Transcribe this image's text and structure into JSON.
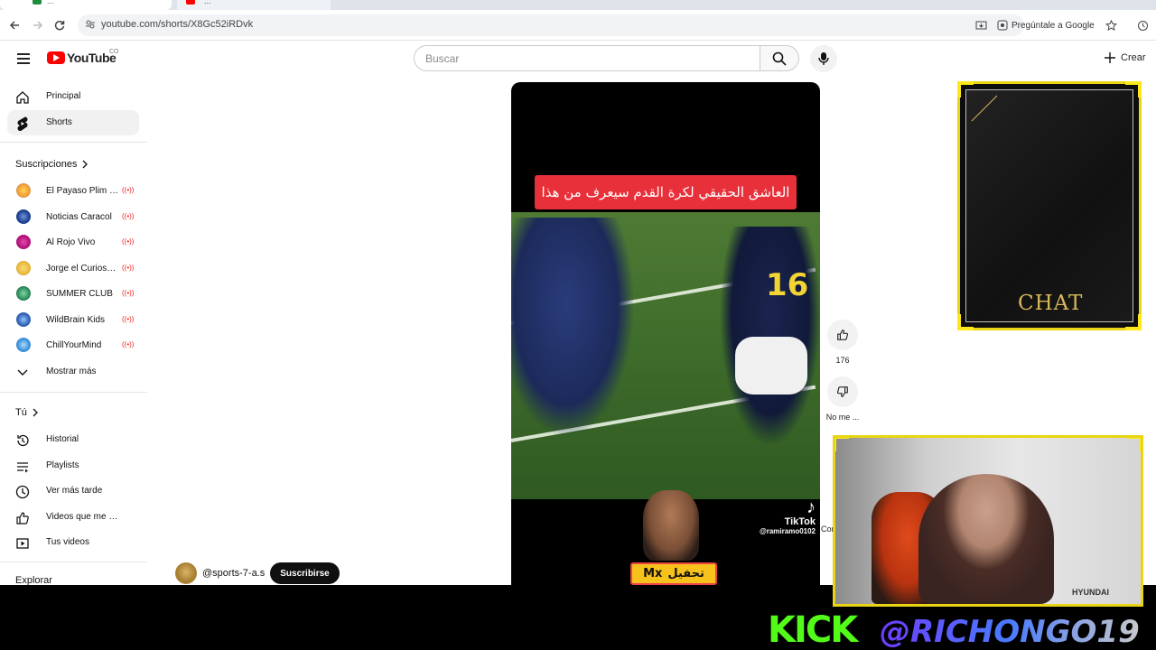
{
  "browser": {
    "tabs": [
      {
        "title": "...",
        "favicon_color": "#1e8e3e"
      },
      {
        "title": "...",
        "favicon_color": "#ff0000"
      }
    ],
    "url": "youtube.com/shorts/X8Gc52iRDvk",
    "ask_google": "Pregúntale a Google"
  },
  "youtube": {
    "logo_text": "YouTube",
    "country_code": "CO",
    "search_placeholder": "Buscar",
    "create_label": "Crear",
    "nav": [
      {
        "label": "Principal",
        "icon": "home-icon"
      },
      {
        "label": "Shorts",
        "icon": "shorts-icon",
        "active": true
      }
    ],
    "subscriptions_heading": "Suscripciones",
    "subscriptions": [
      {
        "name": "El Payaso Plim P...",
        "live": true,
        "avatar_color": "#f4c64a"
      },
      {
        "name": "Noticias Caracol",
        "live": true,
        "avatar_color": "#1c3f8f"
      },
      {
        "name": "Al Rojo Vivo",
        "live": true,
        "avatar_color": "#b0127a"
      },
      {
        "name": "Jorge el Curioso ...",
        "live": true,
        "avatar_color": "#e9b93a"
      },
      {
        "name": "SUMMER CLUB",
        "live": true,
        "avatar_color": "#2c8c5a"
      },
      {
        "name": "WildBrain Kids",
        "live": true,
        "avatar_color": "#2f5fb0"
      },
      {
        "name": "ChillYourMind",
        "live": true,
        "avatar_color": "#3c8fd8"
      }
    ],
    "show_more": "Mostrar más",
    "you_heading": "Tú",
    "you_items": [
      {
        "label": "Historial",
        "icon": "history-icon"
      },
      {
        "label": "Playlists",
        "icon": "playlists-icon"
      },
      {
        "label": "Ver más tarde",
        "icon": "watch-later-icon"
      },
      {
        "label": "Videos que me gus...",
        "icon": "liked-videos-icon"
      },
      {
        "label": "Tus videos",
        "icon": "your-videos-icon"
      }
    ],
    "explore_heading": "Explorar",
    "short": {
      "caption": "العاشق الحقيقي لكرة القدم سيعرف من هذا",
      "jersey_number": "16",
      "tiktok_name": "TikTok",
      "tiktok_handle": "@ramiramo0102",
      "tag_left": "Mx",
      "tag_right": "تحفيل",
      "channel": "@sports-7-a.s",
      "subscribe_label": "Suscribirse"
    },
    "actions": {
      "likes": "176",
      "dislike_label": "No me ...",
      "comments_label": "Com"
    }
  },
  "overlays": {
    "chat_label": "CHAT",
    "cam_brand": "HYUNDAI",
    "kick_logo": "KICK",
    "kick_handle": "@RICHONGO19",
    "frame_color": "#e9d514",
    "kick_color": "#53fc18"
  }
}
